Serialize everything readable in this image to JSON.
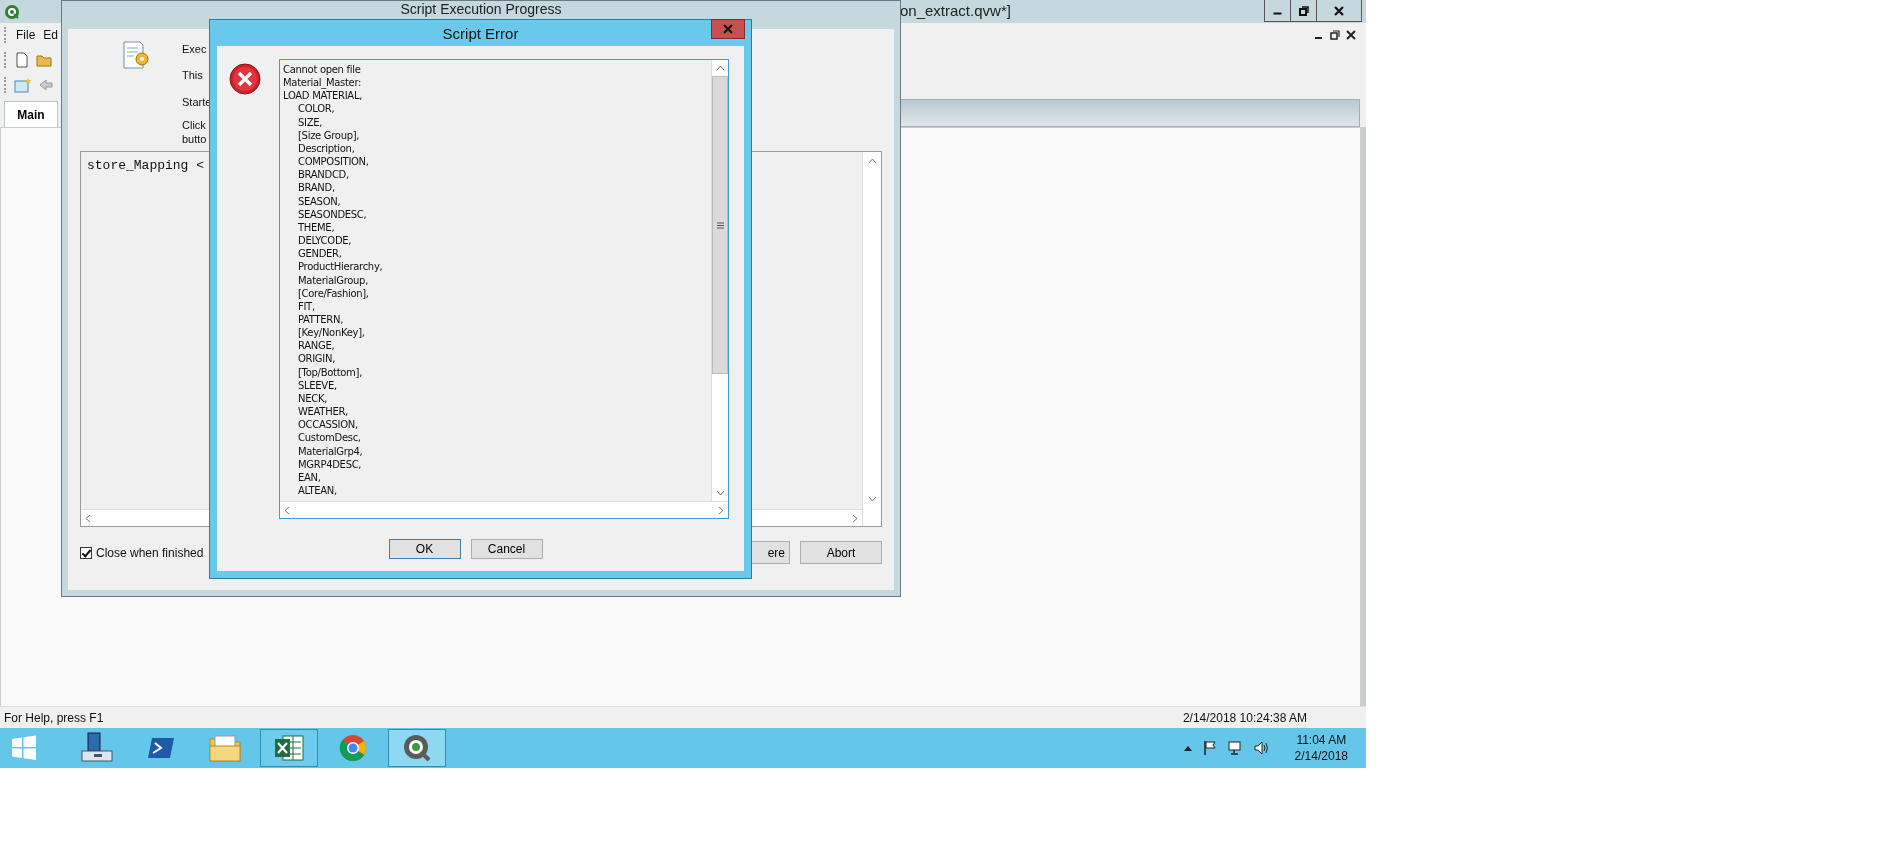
{
  "app_window": {
    "title": "on_extract.qvw*]",
    "menu": [
      "File",
      "Ed"
    ],
    "tabs": [
      {
        "label": "Main",
        "selected": true
      }
    ],
    "status_bar": {
      "help": "For Help, press F1",
      "timestamp": "2/14/2018 10:24:38 AM"
    }
  },
  "progress_dialog": {
    "title": "Script Execution Progress",
    "info_lines": [
      "Exec",
      "This",
      "Starte",
      "Click",
      "butto"
    ],
    "log": "store_Mapping <",
    "close_when_finished": {
      "label": "Close when finished",
      "checked": true
    },
    "buttons": [
      "ere",
      "Abort"
    ]
  },
  "error_dialog": {
    "title": "Script Error",
    "message_lines": [
      "Cannot open file",
      "Material_Master:",
      "LOAD MATERIAL,"
    ],
    "fields": [
      "COLOR,",
      "SIZE,",
      "[Size Group],",
      "Description,",
      "COMPOSITION,",
      "BRANDCD,",
      "BRAND,",
      "SEASON,",
      "SEASONDESC,",
      "THEME,",
      "DELYCODE,",
      "GENDER,",
      "ProductHierarchy,",
      "MaterialGroup,",
      "[Core/Fashion],",
      "FIT,",
      "PATTERN,",
      "[Key/NonKey],",
      "RANGE,",
      "ORIGIN,",
      "[Top/Bottom],",
      "SLEEVE,",
      "NECK,",
      "WEATHER,",
      "OCCASSION,",
      "CustomDesc,",
      "MaterialGrp4,",
      "MGRP4DESC,",
      "EAN,",
      "ALTEAN,"
    ],
    "buttons": [
      "OK",
      "Cancel"
    ]
  },
  "taskbar": {
    "apps": [
      {
        "kind": "start",
        "open": false,
        "selected": false
      },
      {
        "kind": "server",
        "open": false,
        "selected": false
      },
      {
        "kind": "powershell",
        "open": false,
        "selected": false
      },
      {
        "kind": "explorer",
        "open": false,
        "selected": false
      },
      {
        "kind": "excel",
        "open": true,
        "selected": false
      },
      {
        "kind": "chrome",
        "open": false,
        "selected": false
      },
      {
        "kind": "qlik",
        "open": true,
        "selected": true
      }
    ],
    "clock": {
      "time": "11:04 AM",
      "date": "2/14/2018"
    }
  }
}
